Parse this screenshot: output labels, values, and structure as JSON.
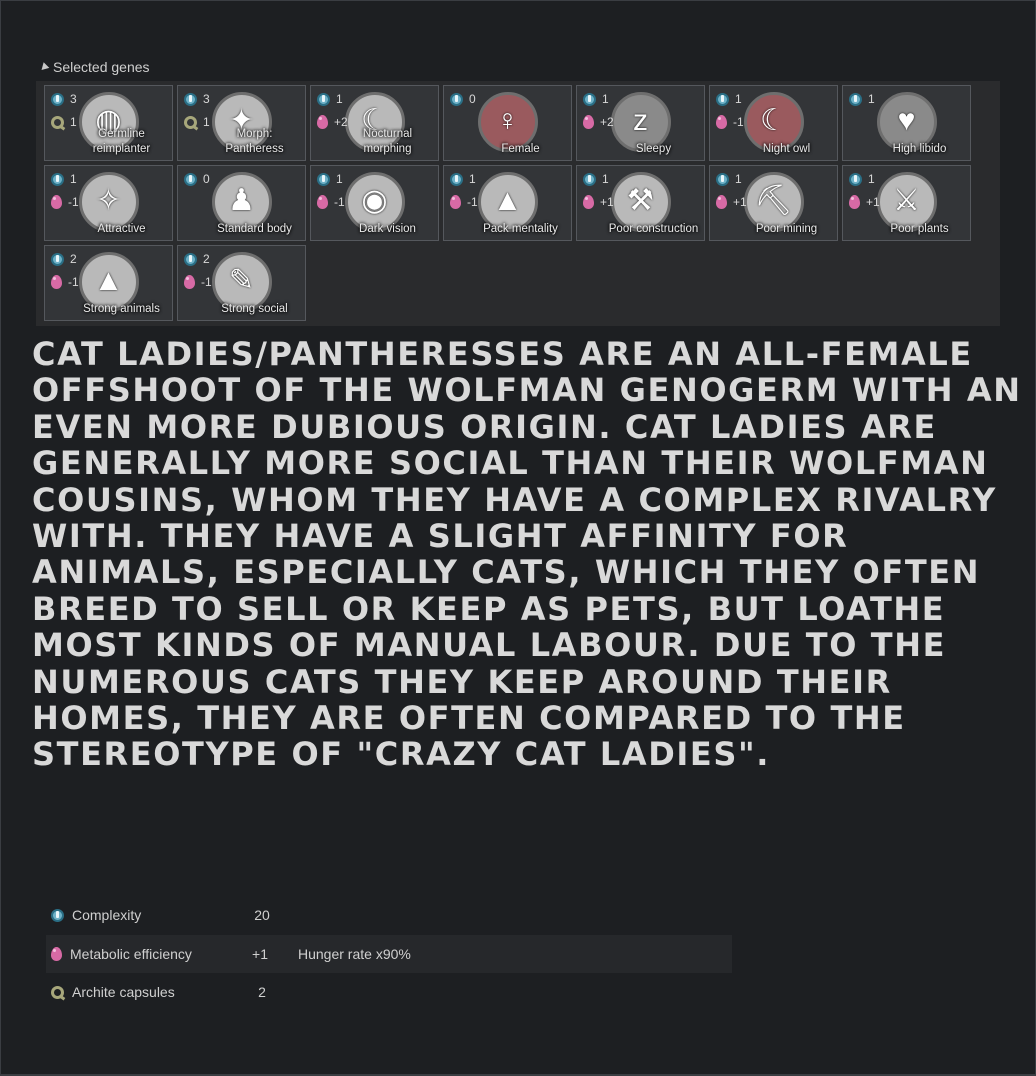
{
  "selected_genes": {
    "header": "Selected genes",
    "genes": [
      {
        "label": "Germline reimplanter",
        "complexity": "3",
        "second_type": "archite",
        "second": "1",
        "glyph": "◍",
        "art": "plain"
      },
      {
        "label": "Morph: Pantheress",
        "complexity": "3",
        "second_type": "archite",
        "second": "1",
        "glyph": "✦",
        "art": "plain"
      },
      {
        "label": "Nocturnal morphing",
        "complexity": "1",
        "second_type": "metabolic",
        "second": "+2",
        "glyph": "☾",
        "art": "plain"
      },
      {
        "label": "Female",
        "complexity": "0",
        "second_type": "none",
        "second": "",
        "glyph": "♀",
        "art": "red"
      },
      {
        "label": "Sleepy",
        "complexity": "1",
        "second_type": "metabolic",
        "second": "+2",
        "glyph": "z",
        "art": "dark"
      },
      {
        "label": "Night owl",
        "complexity": "1",
        "second_type": "metabolic",
        "second": "-1",
        "glyph": "☾",
        "art": "red"
      },
      {
        "label": "High libido",
        "complexity": "1",
        "second_type": "none",
        "second": "",
        "glyph": "♥",
        "art": "dark"
      },
      {
        "label": "Attractive",
        "complexity": "1",
        "second_type": "metabolic",
        "second": "-1",
        "glyph": "✧",
        "art": "plain"
      },
      {
        "label": "Standard body",
        "complexity": "0",
        "second_type": "none",
        "second": "",
        "glyph": "♟",
        "art": "plain"
      },
      {
        "label": "Dark vision",
        "complexity": "1",
        "second_type": "metabolic",
        "second": "-1",
        "glyph": "◉",
        "art": "plain"
      },
      {
        "label": "Pack mentality",
        "complexity": "1",
        "second_type": "metabolic",
        "second": "-1",
        "glyph": "▲",
        "art": "plain"
      },
      {
        "label": "Poor construction",
        "complexity": "1",
        "second_type": "metabolic",
        "second": "+1",
        "glyph": "⚒",
        "art": "plain"
      },
      {
        "label": "Poor mining",
        "complexity": "1",
        "second_type": "metabolic",
        "second": "+1",
        "glyph": "⛏",
        "art": "plain"
      },
      {
        "label": "Poor plants",
        "complexity": "1",
        "second_type": "metabolic",
        "second": "+1",
        "glyph": "⚔",
        "art": "plain"
      },
      {
        "label": "Strong animals",
        "complexity": "2",
        "second_type": "metabolic",
        "second": "-1",
        "glyph": "▲",
        "art": "plain"
      },
      {
        "label": "Strong social",
        "complexity": "2",
        "second_type": "metabolic",
        "second": "-1",
        "glyph": "✎",
        "art": "plain"
      }
    ]
  },
  "description": "Cat Ladies/Pantheresses are an all-female offshoot of the Wolfman genogerm with an even more dubious origin. Cat ladies are generally more social than their Wolfman cousins, whom they have a complex rivalry with. They have a slight affinity for animals, especially cats, which they often breed to sell or keep as pets, but loathe most kinds of manual labour. Due to the numerous cats they keep around their homes, they are often compared to the stereotype of \"crazy cat ladies\".",
  "stats": {
    "complexity": {
      "label": "Complexity",
      "value": "20",
      "icon": "complexity-icon"
    },
    "metabolic": {
      "label": "Metabolic efficiency",
      "value": "+1",
      "extra": "Hunger rate x90%",
      "icon": "metabolic-icon"
    },
    "archite": {
      "label": "Archite capsules",
      "value": "2",
      "icon": "archite-icon"
    }
  },
  "colors": {
    "background": "#1d1f22",
    "complexity": "#6fb2c8",
    "metabolic": "#d76aa5",
    "archite": "#a7a77b"
  }
}
